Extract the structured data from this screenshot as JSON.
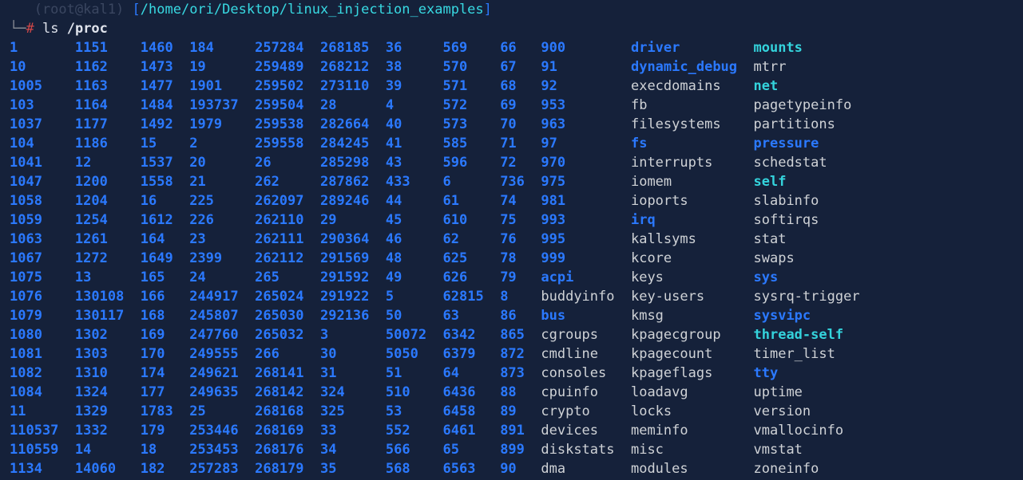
{
  "prompt": {
    "top_line_right": "/home/ori/Desktop/linux_injection_examples",
    "branch": "└─",
    "hash": "#",
    "command": "ls",
    "argument": "/proc"
  },
  "columns": [
    {
      "width": 8,
      "items": [
        {
          "t": "1",
          "c": "dir"
        },
        {
          "t": "10",
          "c": "dir"
        },
        {
          "t": "1005",
          "c": "dir"
        },
        {
          "t": "103",
          "c": "dir"
        },
        {
          "t": "1037",
          "c": "dir"
        },
        {
          "t": "104",
          "c": "dir"
        },
        {
          "t": "1041",
          "c": "dir"
        },
        {
          "t": "1047",
          "c": "dir"
        },
        {
          "t": "1058",
          "c": "dir"
        },
        {
          "t": "1059",
          "c": "dir"
        },
        {
          "t": "1063",
          "c": "dir"
        },
        {
          "t": "1067",
          "c": "dir"
        },
        {
          "t": "1075",
          "c": "dir"
        },
        {
          "t": "1076",
          "c": "dir"
        },
        {
          "t": "1079",
          "c": "dir"
        },
        {
          "t": "1080",
          "c": "dir"
        },
        {
          "t": "1081",
          "c": "dir"
        },
        {
          "t": "1082",
          "c": "dir"
        },
        {
          "t": "1084",
          "c": "dir"
        },
        {
          "t": "11",
          "c": "dir"
        },
        {
          "t": "110537",
          "c": "dir"
        },
        {
          "t": "110559",
          "c": "dir"
        },
        {
          "t": "1134",
          "c": "dir"
        }
      ]
    },
    {
      "width": 8,
      "items": [
        {
          "t": "1151",
          "c": "dir"
        },
        {
          "t": "1162",
          "c": "dir"
        },
        {
          "t": "1163",
          "c": "dir"
        },
        {
          "t": "1164",
          "c": "dir"
        },
        {
          "t": "1177",
          "c": "dir"
        },
        {
          "t": "1186",
          "c": "dir"
        },
        {
          "t": "12",
          "c": "dir"
        },
        {
          "t": "1200",
          "c": "dir"
        },
        {
          "t": "1204",
          "c": "dir"
        },
        {
          "t": "1254",
          "c": "dir"
        },
        {
          "t": "1261",
          "c": "dir"
        },
        {
          "t": "1272",
          "c": "dir"
        },
        {
          "t": "13",
          "c": "dir"
        },
        {
          "t": "130108",
          "c": "dir"
        },
        {
          "t": "130117",
          "c": "dir"
        },
        {
          "t": "1302",
          "c": "dir"
        },
        {
          "t": "1303",
          "c": "dir"
        },
        {
          "t": "1310",
          "c": "dir"
        },
        {
          "t": "1324",
          "c": "dir"
        },
        {
          "t": "1329",
          "c": "dir"
        },
        {
          "t": "1332",
          "c": "dir"
        },
        {
          "t": "14",
          "c": "dir"
        },
        {
          "t": "14060",
          "c": "dir"
        }
      ]
    },
    {
      "width": 6,
      "items": [
        {
          "t": "1460",
          "c": "dir"
        },
        {
          "t": "1473",
          "c": "dir"
        },
        {
          "t": "1477",
          "c": "dir"
        },
        {
          "t": "1484",
          "c": "dir"
        },
        {
          "t": "1492",
          "c": "dir"
        },
        {
          "t": "15",
          "c": "dir"
        },
        {
          "t": "1537",
          "c": "dir"
        },
        {
          "t": "1558",
          "c": "dir"
        },
        {
          "t": "16",
          "c": "dir"
        },
        {
          "t": "1612",
          "c": "dir"
        },
        {
          "t": "164",
          "c": "dir"
        },
        {
          "t": "1649",
          "c": "dir"
        },
        {
          "t": "165",
          "c": "dir"
        },
        {
          "t": "166",
          "c": "dir"
        },
        {
          "t": "168",
          "c": "dir"
        },
        {
          "t": "169",
          "c": "dir"
        },
        {
          "t": "170",
          "c": "dir"
        },
        {
          "t": "174",
          "c": "dir"
        },
        {
          "t": "177",
          "c": "dir"
        },
        {
          "t": "1783",
          "c": "dir"
        },
        {
          "t": "179",
          "c": "dir"
        },
        {
          "t": "18",
          "c": "dir"
        },
        {
          "t": "182",
          "c": "dir"
        }
      ]
    },
    {
      "width": 8,
      "items": [
        {
          "t": "184",
          "c": "dir"
        },
        {
          "t": "19",
          "c": "dir"
        },
        {
          "t": "1901",
          "c": "dir"
        },
        {
          "t": "193737",
          "c": "dir"
        },
        {
          "t": "1979",
          "c": "dir"
        },
        {
          "t": "2",
          "c": "dir"
        },
        {
          "t": "20",
          "c": "dir"
        },
        {
          "t": "21",
          "c": "dir"
        },
        {
          "t": "225",
          "c": "dir"
        },
        {
          "t": "226",
          "c": "dir"
        },
        {
          "t": "23",
          "c": "dir"
        },
        {
          "t": "2399",
          "c": "dir"
        },
        {
          "t": "24",
          "c": "dir"
        },
        {
          "t": "244917",
          "c": "dir"
        },
        {
          "t": "245807",
          "c": "dir"
        },
        {
          "t": "247760",
          "c": "dir"
        },
        {
          "t": "249555",
          "c": "dir"
        },
        {
          "t": "249621",
          "c": "dir"
        },
        {
          "t": "249635",
          "c": "dir"
        },
        {
          "t": "25",
          "c": "dir"
        },
        {
          "t": "253446",
          "c": "dir"
        },
        {
          "t": "253453",
          "c": "dir"
        },
        {
          "t": "257283",
          "c": "dir"
        }
      ]
    },
    {
      "width": 8,
      "items": [
        {
          "t": "257284",
          "c": "dir"
        },
        {
          "t": "259489",
          "c": "dir"
        },
        {
          "t": "259502",
          "c": "dir"
        },
        {
          "t": "259504",
          "c": "dir"
        },
        {
          "t": "259538",
          "c": "dir"
        },
        {
          "t": "259558",
          "c": "dir"
        },
        {
          "t": "26",
          "c": "dir"
        },
        {
          "t": "262",
          "c": "dir"
        },
        {
          "t": "262097",
          "c": "dir"
        },
        {
          "t": "262110",
          "c": "dir"
        },
        {
          "t": "262111",
          "c": "dir"
        },
        {
          "t": "262112",
          "c": "dir"
        },
        {
          "t": "265",
          "c": "dir"
        },
        {
          "t": "265024",
          "c": "dir"
        },
        {
          "t": "265030",
          "c": "dir"
        },
        {
          "t": "265032",
          "c": "dir"
        },
        {
          "t": "266",
          "c": "dir"
        },
        {
          "t": "268141",
          "c": "dir"
        },
        {
          "t": "268142",
          "c": "dir"
        },
        {
          "t": "268168",
          "c": "dir"
        },
        {
          "t": "268169",
          "c": "dir"
        },
        {
          "t": "268176",
          "c": "dir"
        },
        {
          "t": "268179",
          "c": "dir"
        }
      ]
    },
    {
      "width": 8,
      "items": [
        {
          "t": "268185",
          "c": "dir"
        },
        {
          "t": "268212",
          "c": "dir"
        },
        {
          "t": "273110",
          "c": "dir"
        },
        {
          "t": "28",
          "c": "dir"
        },
        {
          "t": "282664",
          "c": "dir"
        },
        {
          "t": "284245",
          "c": "dir"
        },
        {
          "t": "285298",
          "c": "dir"
        },
        {
          "t": "287862",
          "c": "dir"
        },
        {
          "t": "289246",
          "c": "dir"
        },
        {
          "t": "29",
          "c": "dir"
        },
        {
          "t": "290364",
          "c": "dir"
        },
        {
          "t": "291569",
          "c": "dir"
        },
        {
          "t": "291592",
          "c": "dir"
        },
        {
          "t": "291922",
          "c": "dir"
        },
        {
          "t": "292136",
          "c": "dir"
        },
        {
          "t": "3",
          "c": "dir"
        },
        {
          "t": "30",
          "c": "dir"
        },
        {
          "t": "31",
          "c": "dir"
        },
        {
          "t": "324",
          "c": "dir"
        },
        {
          "t": "325",
          "c": "dir"
        },
        {
          "t": "33",
          "c": "dir"
        },
        {
          "t": "34",
          "c": "dir"
        },
        {
          "t": "35",
          "c": "dir"
        }
      ]
    },
    {
      "width": 7,
      "items": [
        {
          "t": "36",
          "c": "dir"
        },
        {
          "t": "38",
          "c": "dir"
        },
        {
          "t": "39",
          "c": "dir"
        },
        {
          "t": "4",
          "c": "dir"
        },
        {
          "t": "40",
          "c": "dir"
        },
        {
          "t": "41",
          "c": "dir"
        },
        {
          "t": "43",
          "c": "dir"
        },
        {
          "t": "433",
          "c": "dir"
        },
        {
          "t": "44",
          "c": "dir"
        },
        {
          "t": "45",
          "c": "dir"
        },
        {
          "t": "46",
          "c": "dir"
        },
        {
          "t": "48",
          "c": "dir"
        },
        {
          "t": "49",
          "c": "dir"
        },
        {
          "t": "5",
          "c": "dir"
        },
        {
          "t": "50",
          "c": "dir"
        },
        {
          "t": "50072",
          "c": "dir"
        },
        {
          "t": "5050",
          "c": "dir"
        },
        {
          "t": "51",
          "c": "dir"
        },
        {
          "t": "510",
          "c": "dir"
        },
        {
          "t": "53",
          "c": "dir"
        },
        {
          "t": "552",
          "c": "dir"
        },
        {
          "t": "566",
          "c": "dir"
        },
        {
          "t": "568",
          "c": "dir"
        }
      ]
    },
    {
      "width": 7,
      "items": [
        {
          "t": "569",
          "c": "dir"
        },
        {
          "t": "570",
          "c": "dir"
        },
        {
          "t": "571",
          "c": "dir"
        },
        {
          "t": "572",
          "c": "dir"
        },
        {
          "t": "573",
          "c": "dir"
        },
        {
          "t": "585",
          "c": "dir"
        },
        {
          "t": "596",
          "c": "dir"
        },
        {
          "t": "6",
          "c": "dir"
        },
        {
          "t": "61",
          "c": "dir"
        },
        {
          "t": "610",
          "c": "dir"
        },
        {
          "t": "62",
          "c": "dir"
        },
        {
          "t": "625",
          "c": "dir"
        },
        {
          "t": "626",
          "c": "dir"
        },
        {
          "t": "62815",
          "c": "dir"
        },
        {
          "t": "63",
          "c": "dir"
        },
        {
          "t": "6342",
          "c": "dir"
        },
        {
          "t": "6379",
          "c": "dir"
        },
        {
          "t": "64",
          "c": "dir"
        },
        {
          "t": "6436",
          "c": "dir"
        },
        {
          "t": "6458",
          "c": "dir"
        },
        {
          "t": "6461",
          "c": "dir"
        },
        {
          "t": "65",
          "c": "dir"
        },
        {
          "t": "6563",
          "c": "dir"
        }
      ]
    },
    {
      "width": 5,
      "items": [
        {
          "t": "66",
          "c": "dir"
        },
        {
          "t": "67",
          "c": "dir"
        },
        {
          "t": "68",
          "c": "dir"
        },
        {
          "t": "69",
          "c": "dir"
        },
        {
          "t": "70",
          "c": "dir"
        },
        {
          "t": "71",
          "c": "dir"
        },
        {
          "t": "72",
          "c": "dir"
        },
        {
          "t": "736",
          "c": "dir"
        },
        {
          "t": "74",
          "c": "dir"
        },
        {
          "t": "75",
          "c": "dir"
        },
        {
          "t": "76",
          "c": "dir"
        },
        {
          "t": "78",
          "c": "dir"
        },
        {
          "t": "79",
          "c": "dir"
        },
        {
          "t": "8",
          "c": "dir"
        },
        {
          "t": "86",
          "c": "dir"
        },
        {
          "t": "865",
          "c": "dir"
        },
        {
          "t": "872",
          "c": "dir"
        },
        {
          "t": "873",
          "c": "dir"
        },
        {
          "t": "88",
          "c": "dir"
        },
        {
          "t": "89",
          "c": "dir"
        },
        {
          "t": "891",
          "c": "dir"
        },
        {
          "t": "899",
          "c": "dir"
        },
        {
          "t": "90",
          "c": "dir"
        }
      ]
    },
    {
      "width": 11,
      "items": [
        {
          "t": "900",
          "c": "dir"
        },
        {
          "t": "91",
          "c": "dir"
        },
        {
          "t": "92",
          "c": "dir"
        },
        {
          "t": "953",
          "c": "dir"
        },
        {
          "t": "963",
          "c": "dir"
        },
        {
          "t": "97",
          "c": "dir"
        },
        {
          "t": "970",
          "c": "dir"
        },
        {
          "t": "975",
          "c": "dir"
        },
        {
          "t": "981",
          "c": "dir"
        },
        {
          "t": "993",
          "c": "dir"
        },
        {
          "t": "995",
          "c": "dir"
        },
        {
          "t": "999",
          "c": "dir"
        },
        {
          "t": "acpi",
          "c": "dir"
        },
        {
          "t": "buddyinfo",
          "c": "file"
        },
        {
          "t": "bus",
          "c": "dir"
        },
        {
          "t": "cgroups",
          "c": "file"
        },
        {
          "t": "cmdline",
          "c": "file"
        },
        {
          "t": "consoles",
          "c": "file"
        },
        {
          "t": "cpuinfo",
          "c": "file"
        },
        {
          "t": "crypto",
          "c": "file"
        },
        {
          "t": "devices",
          "c": "file"
        },
        {
          "t": "diskstats",
          "c": "file"
        },
        {
          "t": "dma",
          "c": "file"
        }
      ]
    },
    {
      "width": 15,
      "items": [
        {
          "t": "driver",
          "c": "dir"
        },
        {
          "t": "dynamic_debug",
          "c": "dir"
        },
        {
          "t": "execdomains",
          "c": "file"
        },
        {
          "t": "fb",
          "c": "file"
        },
        {
          "t": "filesystems",
          "c": "file"
        },
        {
          "t": "fs",
          "c": "dir"
        },
        {
          "t": "interrupts",
          "c": "file"
        },
        {
          "t": "iomem",
          "c": "file"
        },
        {
          "t": "ioports",
          "c": "file"
        },
        {
          "t": "irq",
          "c": "dir"
        },
        {
          "t": "kallsyms",
          "c": "file"
        },
        {
          "t": "kcore",
          "c": "file"
        },
        {
          "t": "keys",
          "c": "file"
        },
        {
          "t": "key-users",
          "c": "file"
        },
        {
          "t": "kmsg",
          "c": "file"
        },
        {
          "t": "kpagecgroup",
          "c": "file"
        },
        {
          "t": "kpagecount",
          "c": "file"
        },
        {
          "t": "kpageflags",
          "c": "file"
        },
        {
          "t": "loadavg",
          "c": "file"
        },
        {
          "t": "locks",
          "c": "file"
        },
        {
          "t": "meminfo",
          "c": "file"
        },
        {
          "t": "misc",
          "c": "file"
        },
        {
          "t": "modules",
          "c": "file"
        }
      ]
    },
    {
      "width": 14,
      "items": [
        {
          "t": "mounts",
          "c": "link"
        },
        {
          "t": "mtrr",
          "c": "file"
        },
        {
          "t": "net",
          "c": "link"
        },
        {
          "t": "pagetypeinfo",
          "c": "file"
        },
        {
          "t": "partitions",
          "c": "file"
        },
        {
          "t": "pressure",
          "c": "dir"
        },
        {
          "t": "schedstat",
          "c": "file"
        },
        {
          "t": "self",
          "c": "link"
        },
        {
          "t": "slabinfo",
          "c": "file"
        },
        {
          "t": "softirqs",
          "c": "file"
        },
        {
          "t": "stat",
          "c": "file"
        },
        {
          "t": "swaps",
          "c": "file"
        },
        {
          "t": "sys",
          "c": "dir"
        },
        {
          "t": "sysrq-trigger",
          "c": "file"
        },
        {
          "t": "sysvipc",
          "c": "dir"
        },
        {
          "t": "thread-self",
          "c": "link"
        },
        {
          "t": "timer_list",
          "c": "file"
        },
        {
          "t": "tty",
          "c": "dir"
        },
        {
          "t": "uptime",
          "c": "file"
        },
        {
          "t": "version",
          "c": "file"
        },
        {
          "t": "vmallocinfo",
          "c": "file"
        },
        {
          "t": "vmstat",
          "c": "file"
        },
        {
          "t": "zoneinfo",
          "c": "file"
        }
      ]
    }
  ]
}
